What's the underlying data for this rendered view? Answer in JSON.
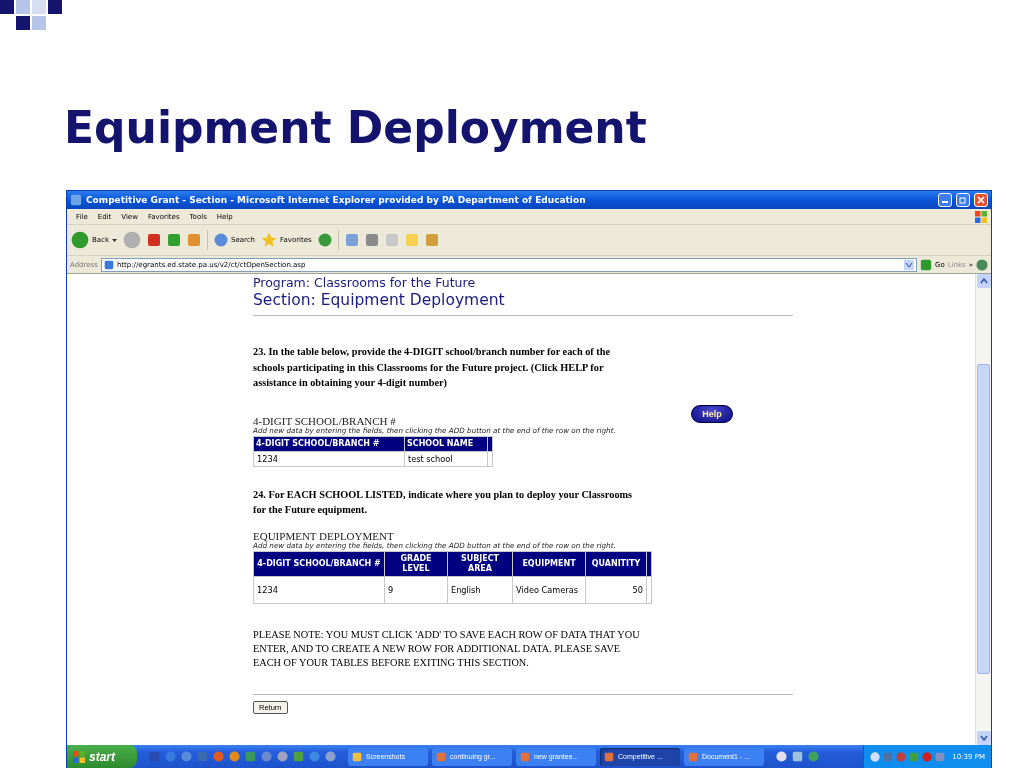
{
  "slide": {
    "title": "Equipment Deployment"
  },
  "window": {
    "title": "Competitive Grant - Section - Microsoft Internet Explorer provided by PA Department of Education",
    "menu": [
      "File",
      "Edit",
      "View",
      "Favorites",
      "Tools",
      "Help"
    ],
    "toolbar": {
      "back": "Back",
      "search": "Search",
      "favorites": "Favorites"
    },
    "address": {
      "label": "Address",
      "value": "http://egrants.ed.state.pa.us/v2/ct/ctOpenSection.asp",
      "go": "Go",
      "links": "Links",
      "more": "»"
    }
  },
  "page": {
    "program": "Program: Classrooms for the Future",
    "section": "Section: Equipment Deployment",
    "question_23": "23. In the table below, provide the 4-DIGIT school/branch number for each of the schools participating in this Classrooms for the Future project. (Click HELP for assistance in obtaining your 4-digit number)",
    "table_1": {
      "title": "4-DIGIT SCHOOL/BRANCH #",
      "hint": "Add new data by entering the fields, then clicking the ADD button at the end of the row on the right.",
      "help": "Help",
      "columns": [
        "4-DIGIT SCHOOL/BRANCH #",
        "SCHOOL NAME"
      ],
      "rows": [
        [
          "1234",
          "test school"
        ]
      ]
    },
    "question_24": "24. For EACH SCHOOL LISTED, indicate where you plan to deploy your Classrooms for the Future equipment.",
    "table_2": {
      "title": "EQUIPMENT DEPLOYMENT",
      "hint": "Add new data by entering the fields, then clicking the ADD button at the end of the row on the right.",
      "columns": [
        "4-DIGIT SCHOOL/BRANCH #",
        "GRADE LEVEL",
        "SUBJECT AREA",
        "EQUIPMENT",
        "QUANITITY"
      ],
      "rows": [
        [
          "1234",
          "9",
          "English",
          "Video Cameras",
          "50"
        ]
      ]
    },
    "note": "PLEASE NOTE: YOU MUST CLICK 'ADD' TO SAVE EACH ROW OF DATA THAT YOU ENTER, AND TO CREATE A NEW ROW FOR ADDITIONAL DATA. PLEASE SAVE EACH OF YOUR TABLES BEFORE EXITING THIS SECTION.",
    "return": "Return"
  },
  "taskbar": {
    "start": "start",
    "tasks": [
      {
        "label": "Screenshots",
        "selected": false
      },
      {
        "label": "continuing gr...",
        "selected": false
      },
      {
        "label": "new grantee...",
        "selected": false
      },
      {
        "label": "Competitive ...",
        "selected": true
      },
      {
        "label": "Document1 - ...",
        "selected": false
      }
    ],
    "clock": "10:39 PM"
  }
}
